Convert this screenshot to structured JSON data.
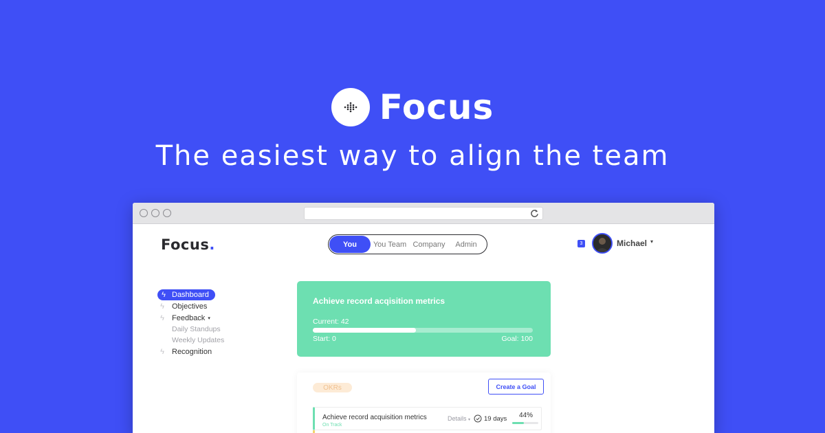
{
  "hero": {
    "brand": "Focus",
    "tagline": "The easiest way to align the team",
    "logo_icon": "diamond-grid-icon"
  },
  "app": {
    "logo_text": "Focus",
    "logo_dot": ".",
    "tabs": [
      {
        "label": "You",
        "active": true
      },
      {
        "label": "You Team",
        "active": false
      },
      {
        "label": "Company",
        "active": false
      },
      {
        "label": "Admin",
        "active": false
      }
    ],
    "notifications_count": "3",
    "user_name": "Michael",
    "caret": "▾"
  },
  "sidebar": {
    "items": [
      {
        "label": "Dashboard",
        "active": true
      },
      {
        "label": "Objectives"
      },
      {
        "label": "Feedback"
      },
      {
        "label": "Daily Standups",
        "sub": true
      },
      {
        "label": "Weekly Updates",
        "sub": true
      },
      {
        "label": "Recognition"
      }
    ]
  },
  "metric": {
    "title": "Achieve record acqisition metrics",
    "current_label": "Current: 42",
    "start_label": "Start: 0",
    "goal_label": "Goal: 100",
    "progress": 0.47
  },
  "okrs": {
    "badge": "OKRs",
    "create_label": "Create a Goal",
    "rows": [
      {
        "name": "Achieve record acquisition metrics",
        "status": "On Track",
        "details_label": "Details",
        "days": "19 days",
        "percent": "44%",
        "progress": 0.44
      }
    ]
  },
  "colors": {
    "brand": "#3f4ff6",
    "success": "#6ddfb1",
    "okr_badge_bg": "#fdebd6",
    "okr_badge_text": "#f0c08f"
  }
}
